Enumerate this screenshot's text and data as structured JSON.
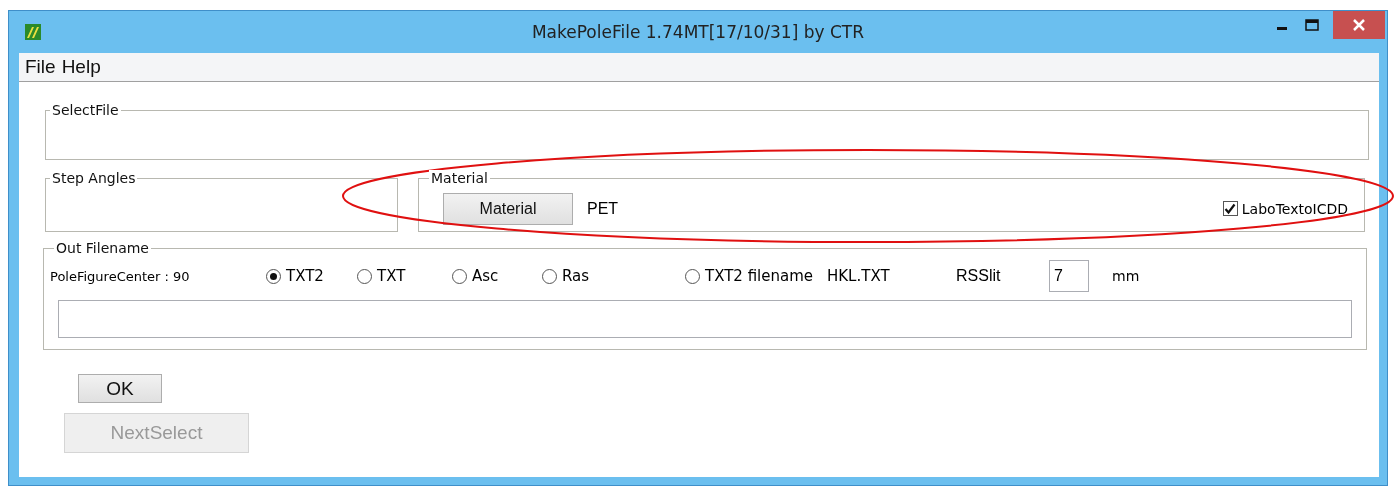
{
  "window": {
    "title": "MakePoleFile 1.74MT[17/10/31] by CTR"
  },
  "menu": [
    {
      "label": "File"
    },
    {
      "label": "Help"
    }
  ],
  "select_file": {
    "legend": "SelectFile"
  },
  "step_angles": {
    "legend": "Step Angles"
  },
  "material": {
    "legend": "Material",
    "button": "Material",
    "value": "PET",
    "checkbox": {
      "label": "LaboTextoICDD",
      "checked": true
    }
  },
  "out_filename": {
    "legend": "Out Filename",
    "pole_figure_center": "PoleFigureCenter : 90",
    "radios": [
      {
        "label": "TXT2",
        "selected": true
      },
      {
        "label": "TXT",
        "selected": false
      },
      {
        "label": "Asc",
        "selected": false
      },
      {
        "label": "Ras",
        "selected": false
      },
      {
        "label": "TXT2 filename",
        "selected": false
      }
    ],
    "txt2_filename": "HKL.TXT",
    "rsslit": {
      "label": "RSSlit",
      "value": "7",
      "unit": "mm"
    }
  },
  "buttons": [
    {
      "label": "OK",
      "disabled": false
    },
    {
      "label": "NextSelect",
      "disabled": true
    }
  ]
}
